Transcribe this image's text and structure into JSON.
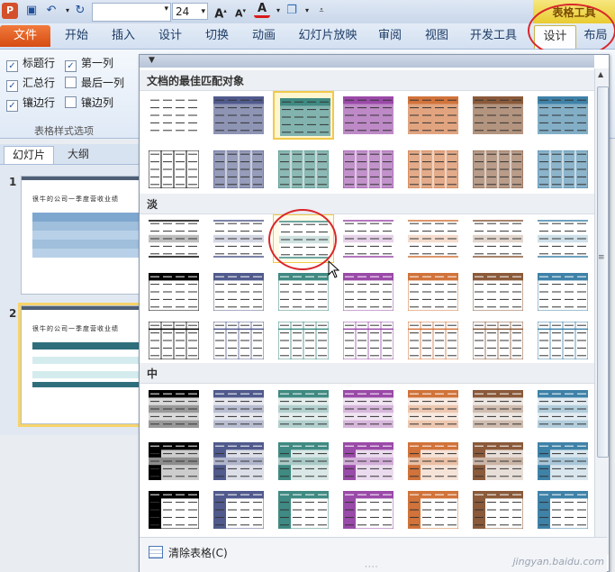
{
  "toolbar": {
    "font_name_value": "",
    "font_size_value": "24",
    "context_header": "表格工具"
  },
  "tabs": [
    {
      "label": "文件"
    },
    {
      "label": "开始"
    },
    {
      "label": "插入"
    },
    {
      "label": "设计"
    },
    {
      "label": "切换"
    },
    {
      "label": "动画"
    },
    {
      "label": "幻灯片放映"
    },
    {
      "label": "审阅"
    },
    {
      "label": "视图"
    },
    {
      "label": "开发工具"
    },
    {
      "label": "设计"
    },
    {
      "label": "布局"
    }
  ],
  "style_options": {
    "group_label": "表格样式选项",
    "checks": [
      {
        "label": "标题行",
        "checked": true
      },
      {
        "label": "第一列",
        "checked": true
      },
      {
        "label": "汇总行",
        "checked": true
      },
      {
        "label": "最后一列",
        "checked": false
      },
      {
        "label": "镶边行",
        "checked": true
      },
      {
        "label": "镶边列",
        "checked": false
      }
    ]
  },
  "pane": {
    "tabs": [
      "幻灯片",
      "大纲"
    ],
    "slides": [
      {
        "number": "1",
        "title": "很牛的公司一季度营收业绩",
        "selected": false
      },
      {
        "number": "2",
        "title": "很牛的公司一季度营收业绩",
        "selected": true
      }
    ]
  },
  "gallery": {
    "sections": [
      {
        "title": "文档的最佳匹配对象"
      },
      {
        "title": "淡"
      },
      {
        "title": "中"
      }
    ],
    "clear_label": "清除表格(C)"
  },
  "colors": {
    "accents": [
      "#6a6a6a",
      "#505a8c",
      "#3f8a82",
      "#9a4aa8",
      "#d1733a",
      "#8a5a3a",
      "#3f82a8"
    ],
    "file_tab": "#e0611f",
    "highlight": "#f2c94c",
    "annotation": "#d9262b"
  },
  "watermark": "jingyan.baidu.com"
}
